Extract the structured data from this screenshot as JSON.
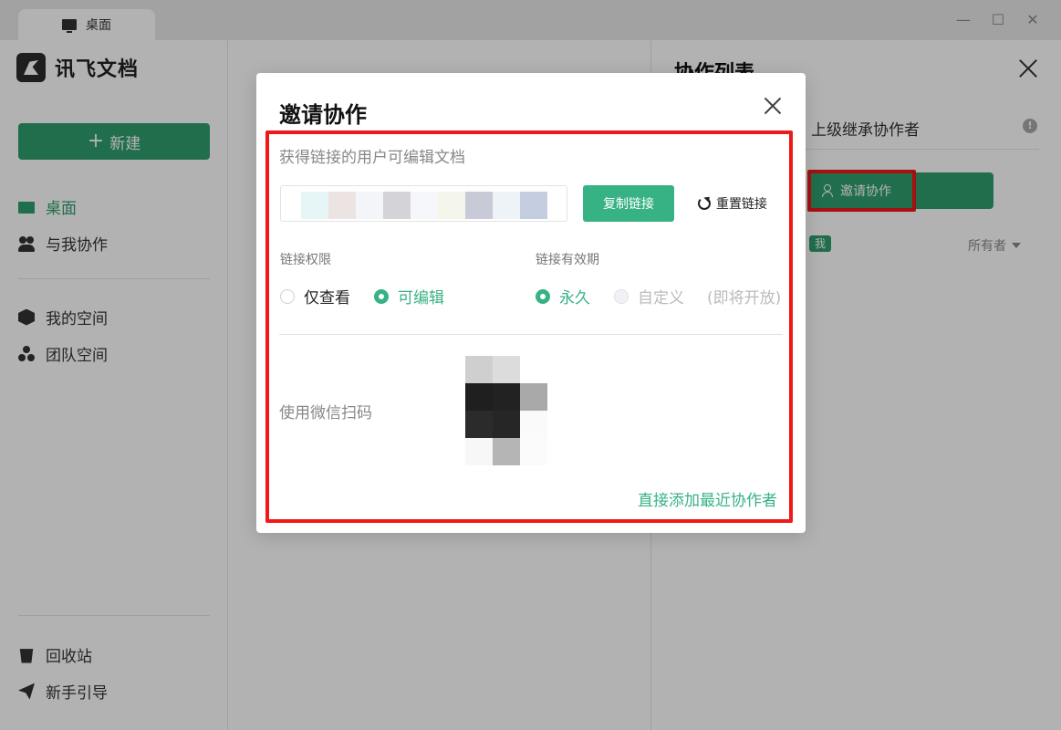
{
  "window": {
    "tab_title": "桌面",
    "minimize": "—",
    "maximize": "☐",
    "close": "✕"
  },
  "sidebar": {
    "logo_text": "讯飞文档",
    "new_button": "新建",
    "new_icon": "+",
    "items": [
      {
        "label": "桌面",
        "icon": "monitor-icon",
        "active": true
      },
      {
        "label": "与我协作",
        "icon": "people-icon"
      },
      {
        "label": "我的空间",
        "icon": "cube-icon"
      },
      {
        "label": "团队空间",
        "icon": "team-icon"
      }
    ],
    "bottom_items": [
      {
        "label": "回收站",
        "icon": "trash-icon"
      },
      {
        "label": "新手引导",
        "icon": "paper-plane-icon"
      }
    ]
  },
  "collab_panel": {
    "title": "协作列表",
    "inherit_label": "上级继承协作者",
    "info_icon": "!",
    "invite_button": "邀请协作",
    "me_badge": "我",
    "role": "所有者"
  },
  "modal": {
    "title": "邀请协作",
    "hint": "获得链接的用户可编辑文档",
    "copy_button": "复制链接",
    "reset_link": "重置链接",
    "permission_label": "链接权限",
    "permission_options": [
      {
        "label": "仅查看",
        "checked": false
      },
      {
        "label": "可编辑",
        "checked": true
      }
    ],
    "validity_label": "链接有效期",
    "validity_options": [
      {
        "label": "永久",
        "checked": true
      },
      {
        "label": "自定义",
        "checked": false,
        "disabled": true
      }
    ],
    "coming_soon": "(即将开放)",
    "wechat_scan": "使用微信扫码",
    "add_recent": "直接添加最近协作者"
  },
  "colors": {
    "accent": "#2f9e6e",
    "accent_light": "#37b284",
    "highlight": "#f01818"
  }
}
